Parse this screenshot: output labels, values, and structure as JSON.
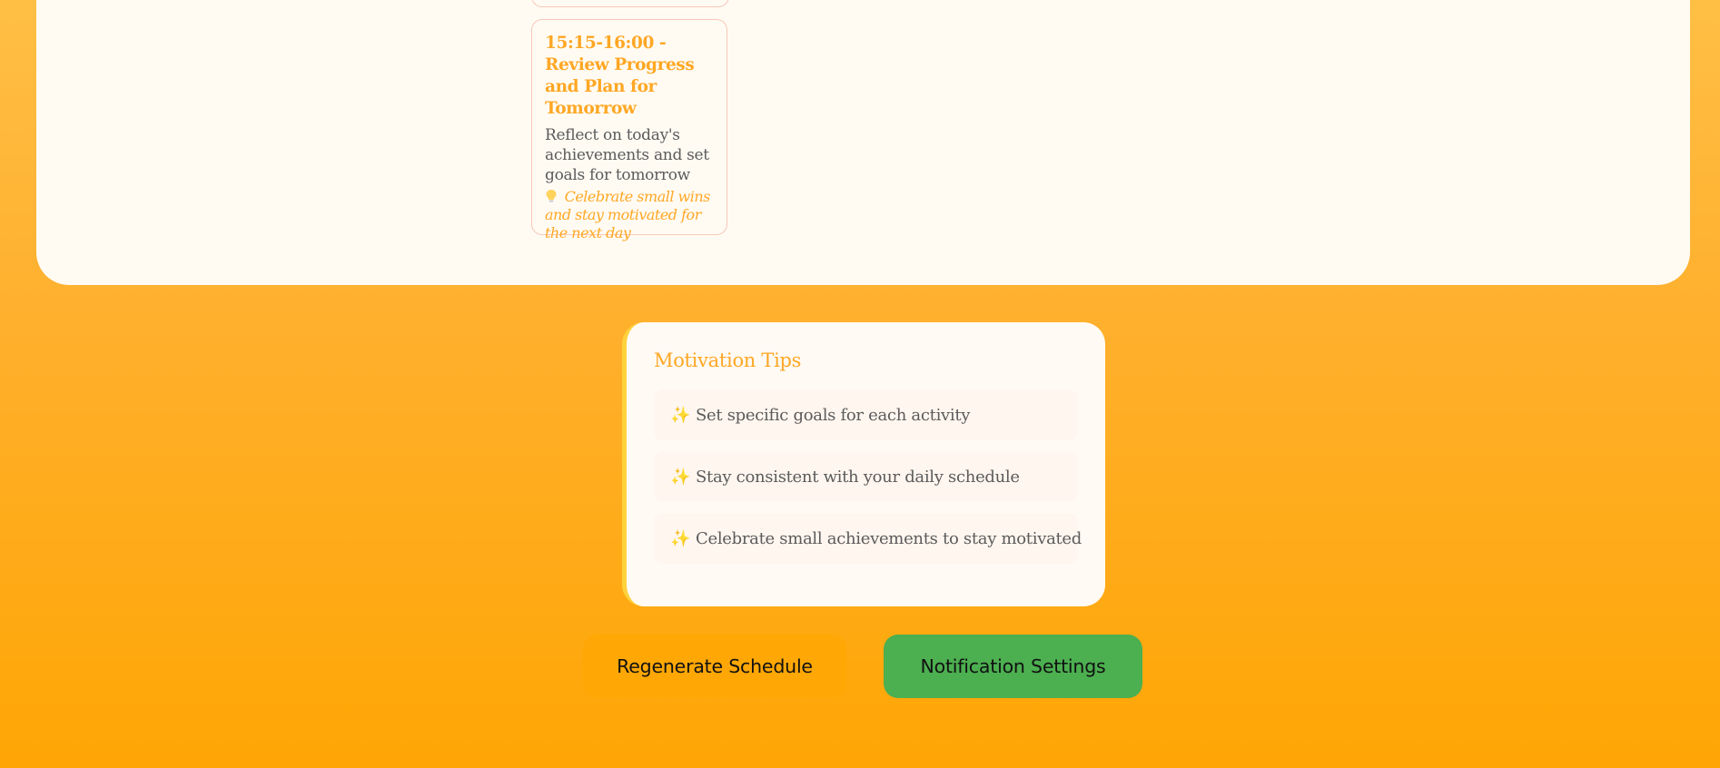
{
  "schedule": {
    "current_event": {
      "title": "15:15-16:00 - Review Progress and Plan for Tomorrow",
      "description": "Reflect on today's achievements and set goals for tomorrow",
      "tip_icon": "lightbulb-icon",
      "tip": "Celebrate small wins and stay motivated for the next day"
    }
  },
  "motivation": {
    "title": "Motivation Tips",
    "tip_icon": "sparkles-icon",
    "tips": [
      {
        "text": "Set specific goals for each activity"
      },
      {
        "text": "Stay consistent with your daily schedule"
      },
      {
        "text": "Celebrate small achievements to stay motivated"
      }
    ]
  },
  "actions": {
    "regenerate_label": "Regenerate Schedule",
    "notification_label": "Notification Settings"
  },
  "colors": {
    "accent": "#ffa724",
    "regenerate_button": "#ffa705",
    "notification_button": "#4caf50",
    "tips_border": "#ffd23c"
  }
}
